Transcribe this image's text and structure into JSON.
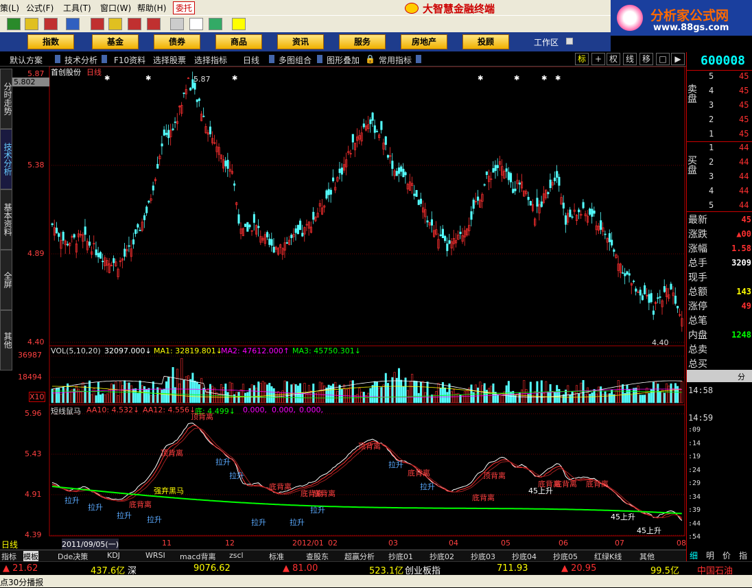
{
  "menu": {
    "items": [
      "策(L)",
      "公式(F)",
      "工具(T)",
      "窗口(W)",
      "帮助(H)"
    ],
    "entrust": "委托",
    "app_title": "大智慧金融终端"
  },
  "brand": {
    "name": "分析家公式网",
    "url": "www.88gs.com"
  },
  "nav": {
    "buttons": [
      "指数",
      "基金",
      "债券",
      "商品",
      "资讯",
      "服务",
      "房地产",
      "投顾"
    ],
    "workarea": "工作区"
  },
  "subbar": {
    "items": [
      "默认方案",
      "技术分析",
      "F10资料",
      "选择股票",
      "选择指标",
      "日线",
      "多图组合",
      "图形叠加",
      "常用指标"
    ],
    "modes": [
      "标",
      "+",
      "权",
      "线",
      "移",
      "□",
      "▶"
    ]
  },
  "side_tabs": [
    "分时走势",
    "技术分析",
    "基本资料",
    "全屏",
    "其他"
  ],
  "chart": {
    "stock_name": "首创股份",
    "period": "日线",
    "price_box": "5.802",
    "price_axis": [
      "5.87",
      "5.38",
      "4.89",
      "4.40"
    ],
    "high_label": "5.87",
    "low_label": "4.40",
    "vol": {
      "label": "VOL(5,10,20)",
      "values": [
        "32097.000↓",
        "MA1: 32819.801↓",
        "MA2: 47612.000↑",
        "MA3: 45750.301↓"
      ],
      "axis": [
        "36987",
        "18494",
        "X10"
      ]
    },
    "ind": {
      "label": "短线鼠马",
      "values": [
        "AA10: 4.532↓",
        "AA12: 4.556↓",
        "底: 4.499↓",
        "0.000,",
        "0.000,",
        "0.000,"
      ],
      "axis": [
        "5.96",
        "5.43",
        "4.91",
        "4.39"
      ],
      "annotations": [
        "顶背离",
        "顶背离",
        "顶背离",
        "顶背离",
        "底背离",
        "底背离",
        "底背离",
        "底背离",
        "底背离",
        "底背离",
        "底背离",
        "底背离",
        "底背离",
        "拉升",
        "拉升",
        "拉升",
        "拉升",
        "拉升",
        "拉升",
        "拉升",
        "拉升",
        "拉升",
        "拉升",
        "拉升",
        "45上升",
        "45上升",
        "45上升",
        "强弃黑马"
      ]
    },
    "date_axis": [
      "2011/09/05(一)",
      "11",
      "12",
      "2012/01",
      "02",
      "03",
      "04",
      "05",
      "06",
      "07",
      "08"
    ],
    "period_tag": "日线",
    "colors": {
      "up": "#ff3030",
      "down": "#54ffff",
      "ma_white": "#ffffff",
      "ma_yellow": "#ffff00",
      "ma_magenta": "#ff00ff",
      "ma_green": "#00ff00"
    }
  },
  "right_panel": {
    "code": "600008",
    "sell_label": "卖盘",
    "buy_label": "买盘",
    "sell_rows": [
      [
        "5",
        "45"
      ],
      [
        "4",
        "45"
      ],
      [
        "3",
        "45"
      ],
      [
        "2",
        "45"
      ],
      [
        "1",
        "45"
      ]
    ],
    "buy_rows": [
      [
        "1",
        "44"
      ],
      [
        "2",
        "44"
      ],
      [
        "3",
        "44"
      ],
      [
        "4",
        "44"
      ],
      [
        "5",
        "44"
      ]
    ],
    "stats": [
      {
        "k": "最新",
        "v": "45",
        "c": "#ff3030"
      },
      {
        "k": "涨跌",
        "v": "▲00",
        "c": "#ff3030"
      },
      {
        "k": "涨幅",
        "v": "1.58",
        "c": "#ff3030"
      },
      {
        "k": "总手",
        "v": "3209",
        "c": "#ffffff"
      },
      {
        "k": "现手",
        "v": "",
        "c": "#ffffff"
      },
      {
        "k": "总额",
        "v": "143",
        "c": "#ffff00"
      },
      {
        "k": "涨停",
        "v": "49",
        "c": "#ff3030"
      },
      {
        "k": "总笔",
        "v": "",
        "c": "#ffffff"
      },
      {
        "k": "内盘",
        "v": "1248",
        "c": "#00ff00"
      },
      {
        "k": "总卖",
        "v": "",
        "c": "#ffffff"
      },
      {
        "k": "总买",
        "v": "",
        "c": "#ffffff"
      }
    ],
    "tab_label": "分",
    "times": [
      "14:58",
      "14:59",
      ":09",
      ":14",
      ":19",
      ":24",
      ":29",
      ":34",
      ":39",
      ":44",
      ":54"
    ],
    "bottom_tabs": [
      "细",
      "明",
      "价",
      "指"
    ]
  },
  "bottom_tabs": [
    "指标",
    "模板",
    "Dde决策",
    "KDJ",
    "WRSI",
    "macd背离",
    "zscl",
    "标准",
    "查股东",
    "超赢分析",
    "抄底01",
    "抄底02",
    "抄底03",
    "抄底04",
    "抄底05",
    "红绿K线",
    "其他"
  ],
  "ticker": [
    {
      "t": "▲ 21.62",
      "c": "#ff3030"
    },
    {
      "t": "437.6亿",
      "c": "#ffff00"
    },
    {
      "t": "深",
      "c": "#ffffff"
    },
    {
      "t": "9076.62",
      "c": "#ffff00"
    },
    {
      "t": "▲ 81.00",
      "c": "#ff3030"
    },
    {
      "t": "523.1亿",
      "c": "#ffff00"
    },
    {
      "t": "创业板指",
      "c": "#ffffff"
    },
    {
      "t": "711.93",
      "c": "#ffff00"
    },
    {
      "t": "▲ 20.95",
      "c": "#ff3030"
    },
    {
      "t": "99.5亿",
      "c": "#ffff00"
    },
    {
      "t": "中国石油",
      "c": "#ff3030"
    }
  ],
  "status": "点30分播报"
}
